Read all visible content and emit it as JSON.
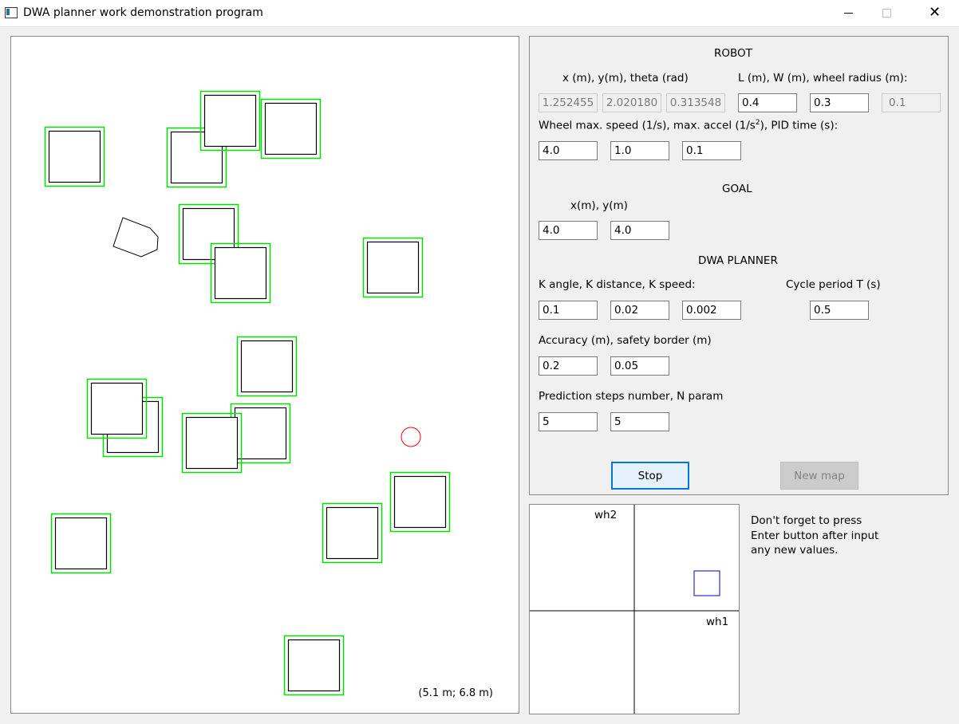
{
  "window": {
    "title": "DWA planner work demonstration program",
    "minimize_icon": "minimize-icon",
    "maximize_icon": "maximize-icon",
    "close_icon": "close-icon",
    "close_glyph": "✕"
  },
  "map": {
    "size_label": "(5.1 m; 6.8 m)",
    "obstacle_color": "#000000",
    "safety_border_color": "#00e000",
    "goal_marker_color": "#ff0000",
    "robot_outline_color": "#000000"
  },
  "robot": {
    "header": "ROBOT",
    "pose_label": "x (m), y(m), theta (rad)",
    "dims_label": "L (m), W (m),  wheel radius (m):",
    "x": "1.252455",
    "y": "2.020180",
    "theta": "0.313548",
    "L": "0.4",
    "W": "0.3",
    "wheel_radius": "0.1",
    "limits_label_prefix": "Wheel max. speed (1/s), max. accel (1/s",
    "limits_label_sup": "2",
    "limits_label_suffix": "), PID time (s):",
    "max_speed": "4.0",
    "max_accel": "1.0",
    "pid_time": "0.1"
  },
  "goal": {
    "header": "GOAL",
    "label": "x(m), y(m)",
    "x": "4.0",
    "y": "4.0"
  },
  "planner": {
    "header": "DWA PLANNER",
    "k_label": "K angle, K distance, K speed:",
    "k_angle": "0.1",
    "k_distance": "0.02",
    "k_speed": "0.002",
    "cycle_label": "Cycle period T (s)",
    "cycle_period": "0.5",
    "accuracy_label": "Accuracy (m), safety border (m)",
    "accuracy": "0.2",
    "safety_border": "0.05",
    "prediction_label": "Prediction steps number, N param",
    "prediction_steps": "5",
    "n_param": "5"
  },
  "buttons": {
    "stop": "Stop",
    "new_map": "New map"
  },
  "wheels": {
    "wh2_label": "wh2",
    "wh1_label": "wh1",
    "indicator_color": "#0000cc"
  },
  "hint": {
    "line1": "Don't forget to press",
    "line2": "Enter button after input",
    "line3": "any new values."
  }
}
